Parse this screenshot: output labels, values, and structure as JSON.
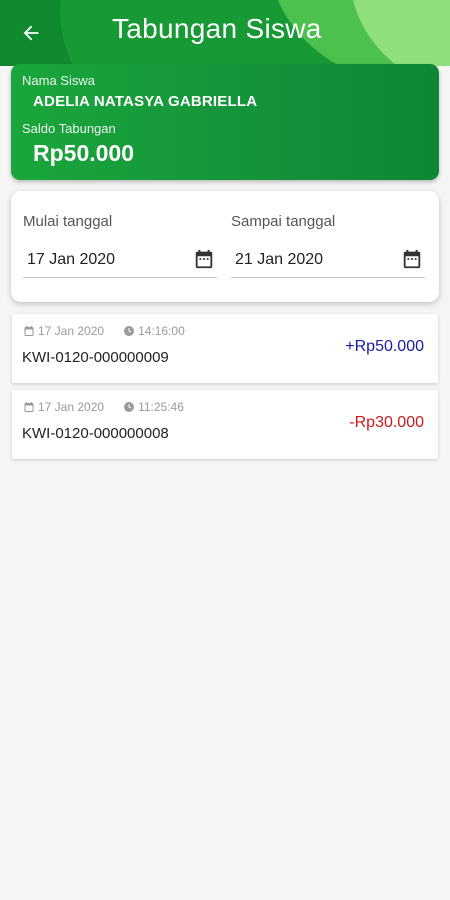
{
  "header": {
    "title": "Tabungan Siswa",
    "back_icon": "arrow-left-icon"
  },
  "student": {
    "name_label": "Nama Siswa",
    "name": "ADELIA NATASYA GABRIELLA",
    "balance_label": "Saldo Tabungan",
    "balance": "Rp50.000"
  },
  "filter": {
    "start_label": "Mulai tanggal",
    "start_value": "17 Jan 2020",
    "end_label": "Sampai tanggal",
    "end_value": "21 Jan 2020"
  },
  "transactions": [
    {
      "date": "17 Jan 2020",
      "time": "14:16:00",
      "id": "KWI-0120-000000009",
      "amount": "+Rp50.000",
      "type": "credit"
    },
    {
      "date": "17 Jan 2020",
      "time": "11:25:46",
      "id": "KWI-0120-000000008",
      "amount": "-Rp30.000",
      "type": "debit"
    }
  ],
  "colors": {
    "primary": "#0f8a2e",
    "credit": "#1a1aa6",
    "debit": "#cc1a1a",
    "background": "#f5f5f5"
  }
}
